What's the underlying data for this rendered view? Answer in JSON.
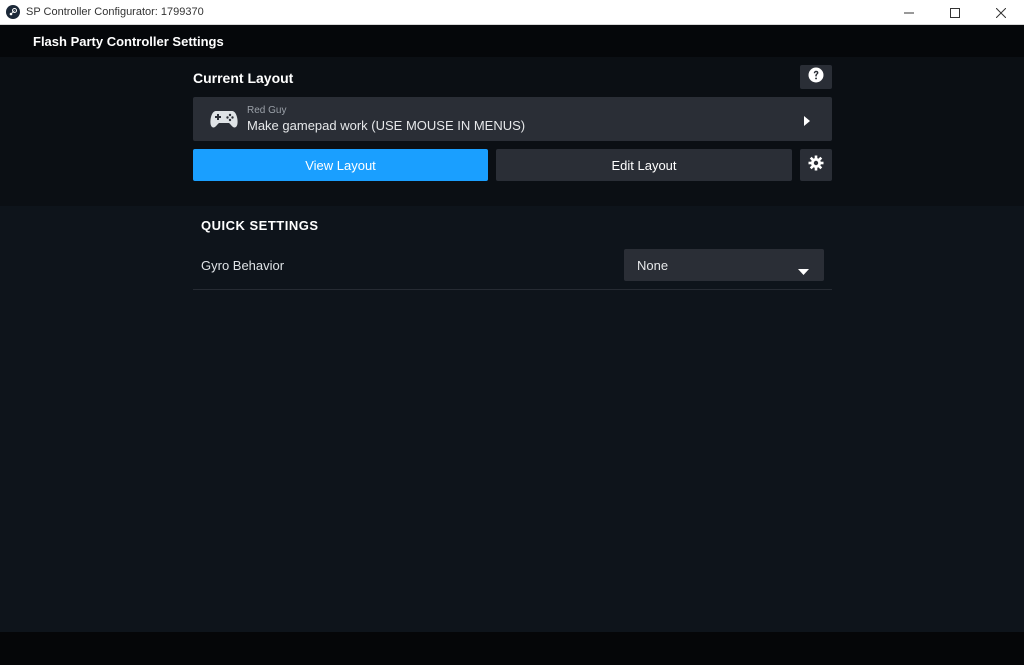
{
  "window": {
    "title": "SP Controller Configurator: 1799370",
    "controls": [
      "—",
      "☐",
      "✕"
    ]
  },
  "header": {
    "title": "Flash Party Controller Settings"
  },
  "current_layout": {
    "section_title": "Current Layout",
    "help_icon": "question-circle-icon",
    "card": {
      "owner": "Red Guy",
      "name": "Make gamepad work (USE MOUSE IN MENUS)",
      "icon": "gamepad-icon",
      "arrow_icon": "chevron-right-icon"
    },
    "view_button": "View Layout",
    "edit_button": "Edit Layout",
    "settings_icon": "gear-icon"
  },
  "quick_settings": {
    "title": "QUICK SETTINGS",
    "rows": [
      {
        "label": "Gyro Behavior",
        "value": "None"
      }
    ]
  },
  "colors": {
    "accent": "#1a9fff",
    "panel": "#2a2e36",
    "background": "#0e141b"
  }
}
